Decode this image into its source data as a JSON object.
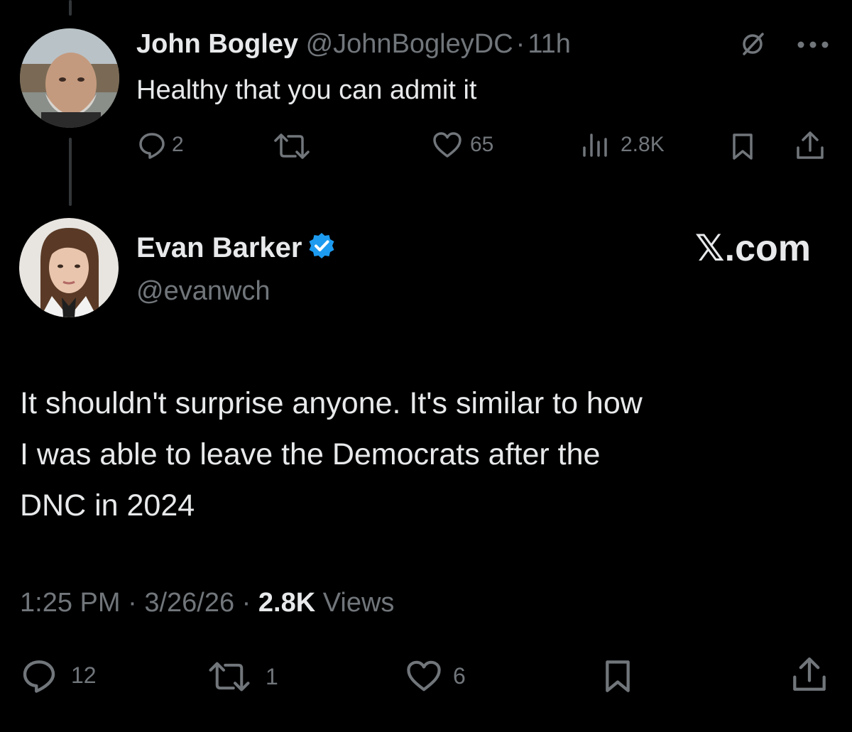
{
  "reply": {
    "author_name": "John Bogley",
    "handle": "@JohnBogleyDC",
    "separator": "·",
    "time": "11h",
    "text": "Healthy that you can admit it",
    "replies": "2",
    "likes": "65",
    "views": "2.8K"
  },
  "post": {
    "author_name": "Evan Barker",
    "handle": "@evanwch",
    "brand": "𝕏.com",
    "text_lines": [
      "It shouldn't surprise anyone. It's similar to how",
      "I was able to leave the Democrats after the",
      "DNC in 2024"
    ],
    "time": "1:25 PM",
    "date": "3/26/26",
    "dot": "·",
    "views_count": "2.8K",
    "views_label": "Views",
    "replies": "12",
    "reposts": "1",
    "likes": "6"
  },
  "colors": {
    "background": "#000000",
    "text": "#e7e9ea",
    "muted": "#71767b",
    "verified": "#1d9bf0"
  },
  "icons": {
    "reply_actions": [
      "reply-icon",
      "repost-icon",
      "like-icon",
      "views-icon",
      "bookmark-icon",
      "share-icon"
    ],
    "header": [
      "grok-icon",
      "more-icon"
    ]
  }
}
